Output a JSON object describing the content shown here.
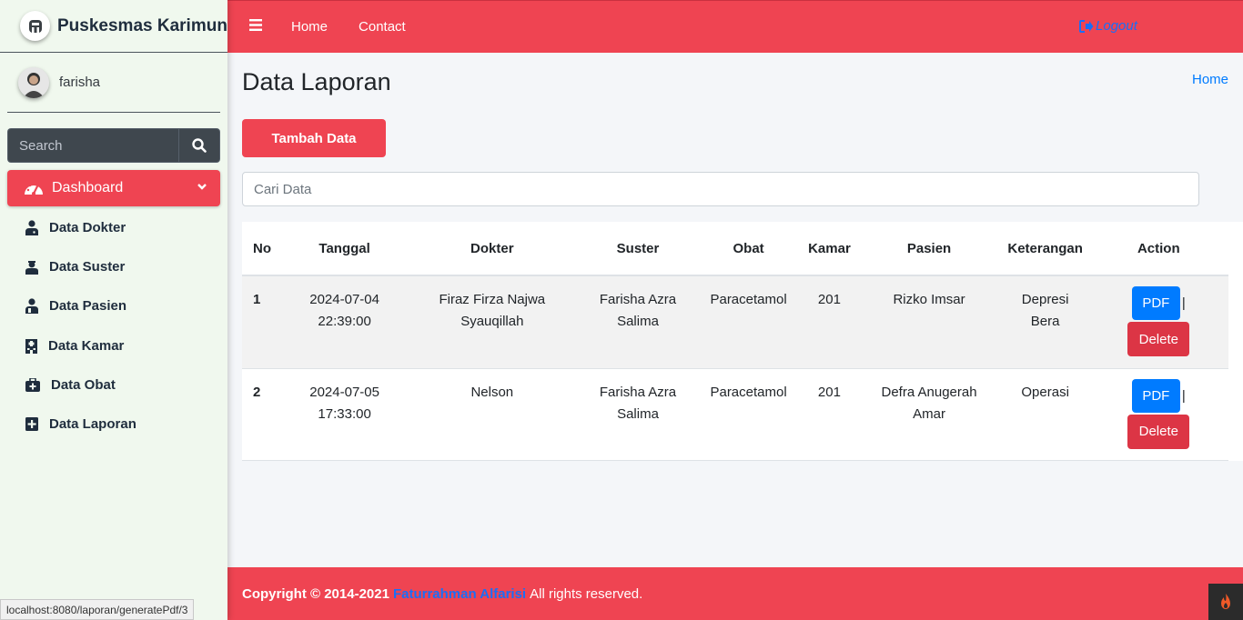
{
  "brand": {
    "name": "Puskesmas Karimun"
  },
  "user": {
    "name": "farisha"
  },
  "sidebar": {
    "search_placeholder": "Search",
    "dashboard_label": "Dashboard",
    "items": [
      {
        "label": "Data Dokter",
        "icon": "user-md-icon"
      },
      {
        "label": "Data Suster",
        "icon": "user-nurse-icon"
      },
      {
        "label": "Data Pasien",
        "icon": "user-injured-icon"
      },
      {
        "label": "Data Kamar",
        "icon": "hospital-icon"
      },
      {
        "label": "Data Obat",
        "icon": "medkit-icon"
      },
      {
        "label": "Data Laporan",
        "icon": "file-medical-icon"
      }
    ]
  },
  "navbar": {
    "links": [
      "Home",
      "Contact"
    ],
    "logout": "Logout"
  },
  "page": {
    "title": "Data Laporan",
    "breadcrumb": "Home",
    "add_button": "Tambah Data",
    "search_placeholder": "Cari Data"
  },
  "table": {
    "headers": [
      "No",
      "Tanggal",
      "Dokter",
      "Suster",
      "Obat",
      "Kamar",
      "Pasien",
      "Keterangan",
      "Action"
    ],
    "rows": [
      {
        "no": "1",
        "tanggal_date": "2024-07-04",
        "tanggal_time": "22:39:00",
        "dokter_1": "Firaz Firza Najwa",
        "dokter_2": "Syauqillah",
        "suster_1": "Farisha Azra",
        "suster_2": "Salima",
        "obat": "Paracetamol",
        "kamar": "201",
        "pasien_1": "Rizko Imsar",
        "pasien_2": "",
        "ket_1": "Depresi",
        "ket_2": "Bera",
        "pdf": "PDF",
        "sep": "|",
        "delete": "Delete"
      },
      {
        "no": "2",
        "tanggal_date": "2024-07-05",
        "tanggal_time": "17:33:00",
        "dokter_1": "Nelson",
        "dokter_2": "",
        "suster_1": "Farisha Azra",
        "suster_2": "Salima",
        "obat": "Paracetamol",
        "kamar": "201",
        "pasien_1": "Defra Anugerah",
        "pasien_2": "Amar",
        "ket_1": "Operasi",
        "ket_2": "",
        "pdf": "PDF",
        "sep": "|",
        "delete": "Delete"
      }
    ]
  },
  "footer": {
    "copyright": "Copyright © 2014-2021",
    "author": "Faturrahman Alfarisi",
    "rights": "All rights reserved."
  },
  "status_bar": {
    "url": "localhost:8080/laporan/generatePdf/3"
  },
  "colors": {
    "primary": "#ef4452",
    "sidebar_bg": "#f0f8ee",
    "link": "#007bff",
    "danger": "#dc3545"
  }
}
